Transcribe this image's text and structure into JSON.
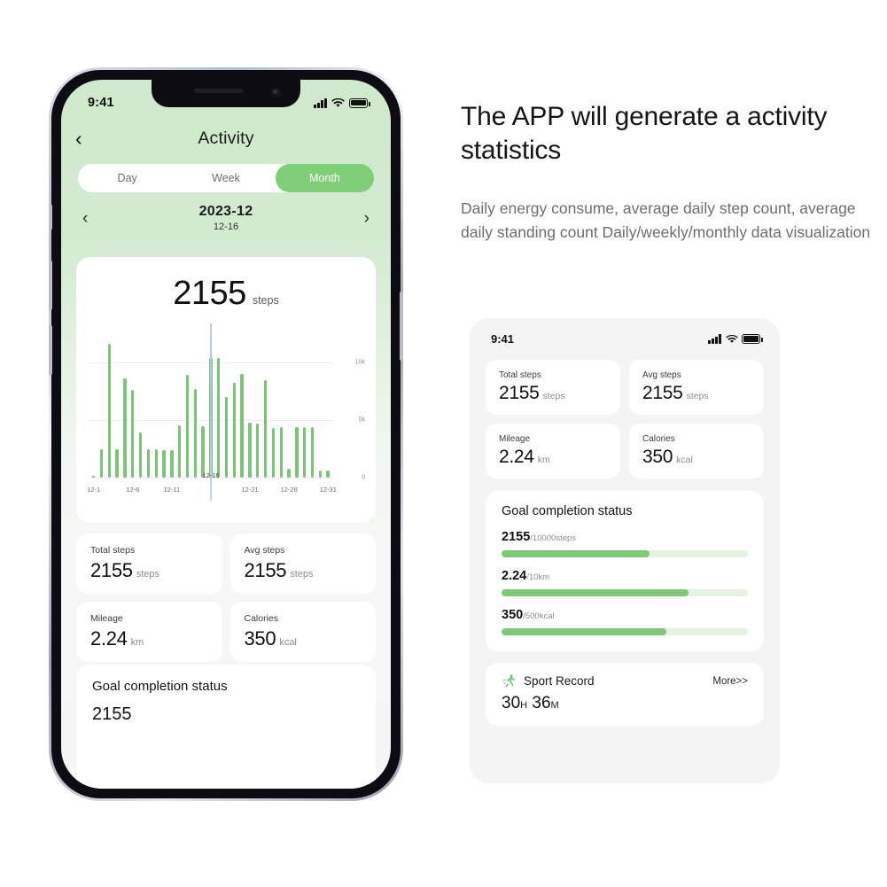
{
  "phone": {
    "status_bar": {
      "time": "9:41",
      "signal_icon": "cellular-signal-icon",
      "wifi_icon": "wifi-icon",
      "battery_icon": "battery-icon"
    },
    "nav": {
      "back_icon": "chevron-left-icon",
      "title": "Activity"
    },
    "segment": {
      "options": [
        "Day",
        "Week",
        "Month"
      ],
      "selected": "Month"
    },
    "month_selector": {
      "prev_icon": "chevron-left-icon",
      "next_icon": "chevron-right-icon",
      "title": "2023-12",
      "subtitle": "12-16"
    },
    "summary": {
      "value": "2155",
      "unit": "steps"
    },
    "stats": [
      {
        "label": "Total steps",
        "value": "2155",
        "unit": "steps"
      },
      {
        "label": "Avg steps",
        "value": "2155",
        "unit": "steps"
      },
      {
        "label": "Mileage",
        "value": "2.24",
        "unit": "km"
      },
      {
        "label": "Calories",
        "value": "350",
        "unit": "kcal"
      }
    ],
    "goal": {
      "title": "Goal completion status",
      "peek_value": "2155"
    }
  },
  "marketing": {
    "headline": "The APP will generate a activity statistics",
    "body": "Daily energy consume, average daily step count, average daily standing count Daily/weekly/monthly data visualization"
  },
  "panel": {
    "status_bar": {
      "time": "9:41",
      "signal_icon": "cellular-signal-icon",
      "wifi_icon": "wifi-icon",
      "battery_icon": "battery-icon"
    },
    "stats": [
      {
        "label": "Total steps",
        "value": "2155",
        "unit": "steps"
      },
      {
        "label": "Avg steps",
        "value": "2155",
        "unit": "steps"
      },
      {
        "label": "Mileage",
        "value": "2.24",
        "unit": "km"
      },
      {
        "label": "Calories",
        "value": "350",
        "unit": "kcal"
      }
    ],
    "goal": {
      "title": "Goal completion status",
      "rows": [
        {
          "value": "2155",
          "target": "/10000steps",
          "percent": 60
        },
        {
          "value": "2.24",
          "target": "/10km",
          "percent": 76
        },
        {
          "value": "350",
          "target": "/500kcal",
          "percent": 67
        }
      ]
    },
    "sport": {
      "icon": "running-person-icon",
      "label": "Sport Record",
      "more": "More>>",
      "hours": "30",
      "hours_unit": "H",
      "minutes": "36",
      "minutes_unit": "M"
    }
  },
  "colors": {
    "accent_green": "#7fcf78",
    "bar_green": "#7cc576",
    "track_green": "#e3f2e1",
    "screen_top": "#cfe9cc",
    "panel_bg": "#f4f4f4",
    "highlight_line": "#b9cdf2"
  },
  "chart_data": {
    "type": "bar",
    "title": "",
    "xlabel": "",
    "ylabel": "",
    "ylim": [
      0,
      12000
    ],
    "grid": true,
    "legend": "none",
    "yticks": [
      0,
      5000,
      10000
    ],
    "ytick_labels": [
      "0",
      "5k",
      "10k"
    ],
    "xtick_labels": [
      "12-1",
      "12-6",
      "12-11",
      "12-16",
      "12-21",
      "12-26",
      "12-31"
    ],
    "highlight_x": "12-16",
    "categories": [
      "12-1",
      "12-2",
      "12-3",
      "12-4",
      "12-5",
      "12-6",
      "12-7",
      "12-8",
      "12-9",
      "12-10",
      "12-11",
      "12-12",
      "12-13",
      "12-14",
      "12-15",
      "12-16",
      "12-17",
      "12-18",
      "12-19",
      "12-20",
      "12-21",
      "12-22",
      "12-23",
      "12-24",
      "12-25",
      "12-26",
      "12-27",
      "12-28",
      "12-29",
      "12-30",
      "12-31"
    ],
    "values": [
      120,
      2450,
      11600,
      2450,
      8600,
      7600,
      3900,
      2450,
      2450,
      2400,
      2400,
      4550,
      8900,
      7700,
      4500,
      10400,
      10400,
      7000,
      8200,
      9000,
      4750,
      4700,
      8500,
      4300,
      4350,
      800,
      4350,
      4350,
      4350,
      600,
      650
    ]
  }
}
